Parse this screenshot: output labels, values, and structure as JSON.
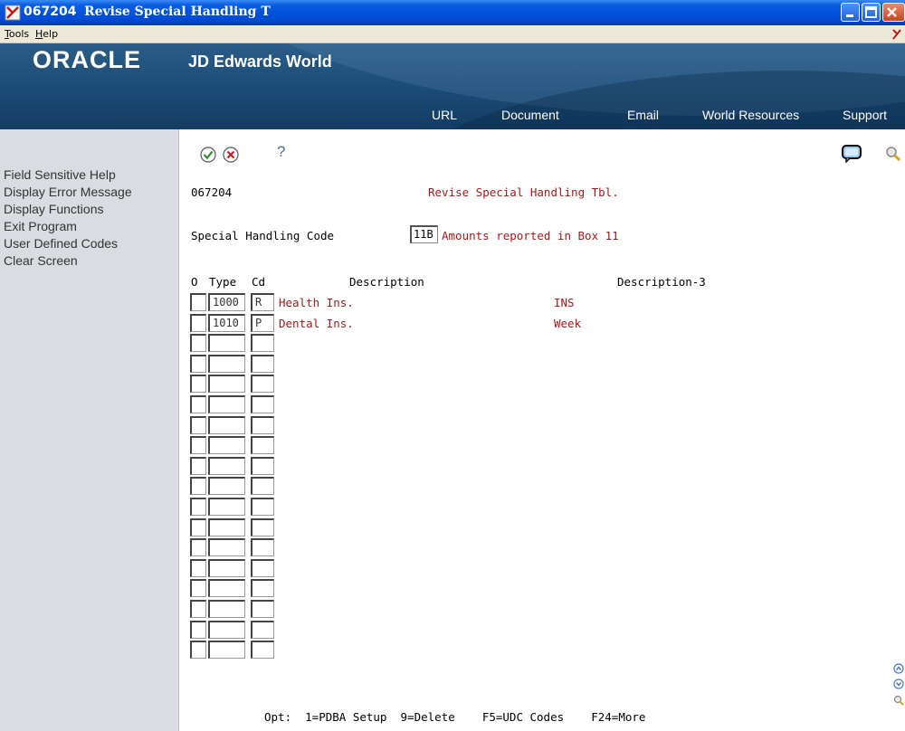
{
  "window": {
    "program_id": "067204",
    "title": "Revise Special Handling T"
  },
  "menubar": {
    "tools_first": "T",
    "tools_rest": "ools",
    "help_first": "H",
    "help_rest": "elp"
  },
  "banner": {
    "oracle": "ORACLE",
    "product": "JD Edwards World",
    "links": [
      "URL",
      "Document",
      "Email",
      "World Resources",
      "Support"
    ]
  },
  "leftpane": {
    "items": [
      "Field Sensitive Help",
      "Display Error Message",
      "Display Functions",
      "Exit Program",
      "User Defined Codes",
      "Clear Screen"
    ]
  },
  "toolbar": {
    "help_glyph": "?"
  },
  "form": {
    "program_id": "067204",
    "heading": "Revise Special Handling Tbl.",
    "sh_label": "Special Handling Code",
    "sh_value": "11B",
    "sh_description": "Amounts reported in Box 11",
    "columns": {
      "option": "O",
      "type": "Type",
      "cd": "Cd",
      "description": "Description",
      "description3": "Description-3"
    },
    "rows": [
      {
        "option": "",
        "type": "1000",
        "cd": "R",
        "description": "Health Ins.",
        "description3": "INS"
      },
      {
        "option": "",
        "type": "1010",
        "cd": "P",
        "description": "Dental Ins.",
        "description3": "Week"
      },
      {
        "option": "",
        "type": "",
        "cd": "",
        "description": "",
        "description3": ""
      },
      {
        "option": "",
        "type": "",
        "cd": "",
        "description": "",
        "description3": ""
      },
      {
        "option": "",
        "type": "",
        "cd": "",
        "description": "",
        "description3": ""
      },
      {
        "option": "",
        "type": "",
        "cd": "",
        "description": "",
        "description3": ""
      },
      {
        "option": "",
        "type": "",
        "cd": "",
        "description": "",
        "description3": ""
      },
      {
        "option": "",
        "type": "",
        "cd": "",
        "description": "",
        "description3": ""
      },
      {
        "option": "",
        "type": "",
        "cd": "",
        "description": "",
        "description3": ""
      },
      {
        "option": "",
        "type": "",
        "cd": "",
        "description": "",
        "description3": ""
      },
      {
        "option": "",
        "type": "",
        "cd": "",
        "description": "",
        "description3": ""
      },
      {
        "option": "",
        "type": "",
        "cd": "",
        "description": "",
        "description3": ""
      },
      {
        "option": "",
        "type": "",
        "cd": "",
        "description": "",
        "description3": ""
      },
      {
        "option": "",
        "type": "",
        "cd": "",
        "description": "",
        "description3": ""
      },
      {
        "option": "",
        "type": "",
        "cd": "",
        "description": "",
        "description3": ""
      },
      {
        "option": "",
        "type": "",
        "cd": "",
        "description": "",
        "description3": ""
      },
      {
        "option": "",
        "type": "",
        "cd": "",
        "description": "",
        "description3": ""
      },
      {
        "option": "",
        "type": "",
        "cd": "",
        "description": "",
        "description3": ""
      }
    ],
    "footer": "Opt:  1=PDBA Setup  9=Delete    F5=UDC Codes    F24=More"
  },
  "colors": {
    "title_bar": "#0050dc",
    "banner": "#1a4b76",
    "left_pane": "#d9dce0",
    "form_red": "#a11a1a"
  }
}
